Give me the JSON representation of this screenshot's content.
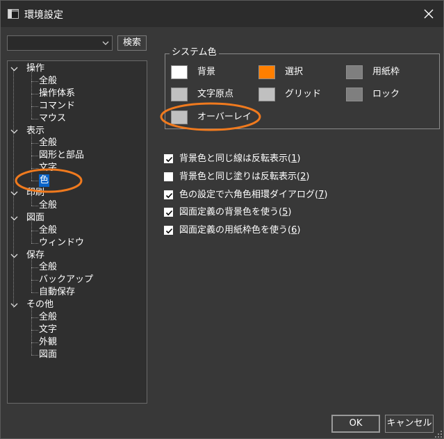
{
  "window": {
    "title": "環境設定"
  },
  "search": {
    "value": "",
    "button_label": "検索"
  },
  "tree": {
    "groups": [
      {
        "label": "操作",
        "items": [
          "全般",
          "操作体系",
          "コマンド",
          "マウス"
        ]
      },
      {
        "label": "表示",
        "items": [
          "全般",
          "図形と部品",
          "文字",
          "色"
        ]
      },
      {
        "label": "印刷",
        "items": [
          "全般"
        ]
      },
      {
        "label": "図面",
        "items": [
          "全般",
          "ウィンドウ"
        ]
      },
      {
        "label": "保存",
        "items": [
          "全般",
          "バックアップ",
          "自動保存"
        ]
      },
      {
        "label": "その他",
        "items": [
          "全般",
          "文字",
          "外観",
          "図面"
        ]
      }
    ],
    "selected": "色"
  },
  "system_colors": {
    "title": "システム色",
    "swatches": [
      {
        "label": "背景",
        "color": "#ffffff"
      },
      {
        "label": "選択",
        "color": "#ff7f00"
      },
      {
        "label": "用紙枠",
        "color": "#7f7f7f"
      },
      {
        "label": "文字原点",
        "color": "#c0c0c0"
      },
      {
        "label": "グリッド",
        "color": "#c0c0c0"
      },
      {
        "label": "ロック",
        "color": "#7f7f7f"
      },
      {
        "label": "オーバーレイ",
        "color": "#c0c0c0"
      }
    ]
  },
  "options": [
    {
      "text": "背景色と同じ線は反転表示(",
      "key": "1",
      "end": ")",
      "checked": true
    },
    {
      "text": "背景色と同じ塗りは反転表示(",
      "key": "2",
      "end": ")",
      "checked": false
    },
    {
      "text": "色の設定で六角色相環ダイアログ(",
      "key": "7",
      "end": ")",
      "checked": true
    },
    {
      "text": "図面定義の背景色を使う(",
      "key": "5",
      "end": ")",
      "checked": true
    },
    {
      "text": "図面定義の用紙枠色を使う(",
      "key": "6",
      "end": ")",
      "checked": true
    }
  ],
  "buttons": {
    "ok": "OK",
    "cancel": "キャンセル"
  },
  "annotation": {
    "color": "#f07a1e"
  }
}
